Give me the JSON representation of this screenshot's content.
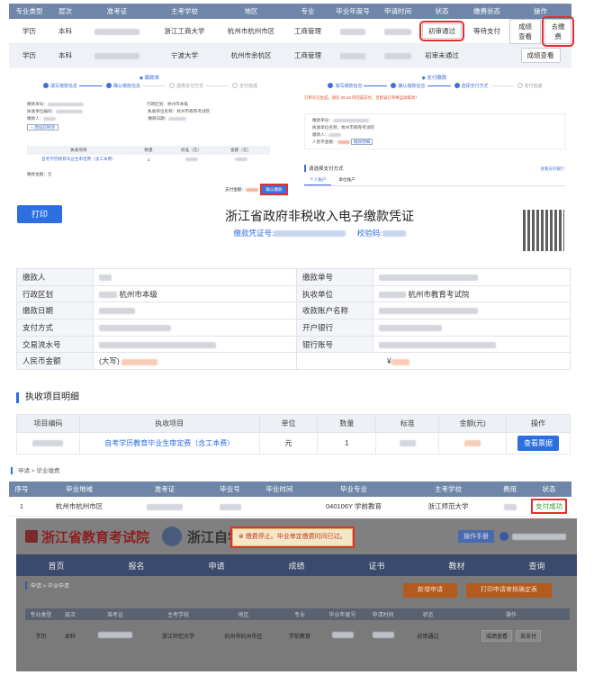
{
  "top_table": {
    "headers": [
      "专业类型",
      "层次",
      "准考证",
      "主考学校",
      "地区",
      "专业",
      "毕业年度号",
      "申请时间",
      "状态",
      "缴费状态",
      "操作"
    ],
    "rows": [
      {
        "type": "学历",
        "level": "本科",
        "school": "浙江工商大学",
        "region": "杭州市杭州市区",
        "major": "工商管理",
        "status": "初审通过",
        "pay_status": "等待支付",
        "btn1": "成绩查看",
        "btn2": "去缴费"
      },
      {
        "type": "学历",
        "level": "本科",
        "school": "宁波大学",
        "region": "杭州市余杭区",
        "major": "工商管理",
        "status": "初审未通过",
        "btn1": "成绩查看"
      }
    ]
  },
  "left_panel": {
    "title": "缴款单",
    "steps": [
      "填写缴款信息",
      "确认缴款信息",
      "选择支付方式",
      "支付完成"
    ],
    "labels": [
      "缴款单号：",
      "执收单位编码：",
      "缴款人：",
      "行政区划：",
      "执收单位名称：",
      "缴款日期："
    ],
    "values": [
      "杭州市本级",
      "杭州市教育考试院"
    ],
    "add_link": "+ 添加非税项",
    "item_head": [
      "执收项目",
      "数量",
      "标准（元）",
      "金额（元）"
    ],
    "item": "自考学历教育毕业生审定费（含工本费）",
    "qty": "1",
    "total_label": "缴款金额：元",
    "pay_label": "支付金额：",
    "confirm": "确认缴款"
  },
  "right_panel": {
    "title": "支付缴款",
    "steps": [
      "填写缴款信息",
      "确认缴款信息",
      "选择支付方式",
      "支付完成"
    ],
    "warning": "订单号已生成，请在 29:43 内完成支付，否则该订单将自动取消！",
    "labels": [
      "缴款单号：",
      "执收单位名称：杭州市教育考试院",
      "缴款人：",
      "人民币金额："
    ],
    "detail": "缴款明细",
    "section": "请选择支付方式",
    "bank_link": "查看支持银行",
    "tabs": [
      "个人账户",
      "单位账户"
    ]
  },
  "voucher": {
    "print": "打印",
    "title": "浙江省政府非税收入电子缴款凭证",
    "code_label": "缴款凭证号:",
    "check_label": "校验码:",
    "rows": [
      [
        "缴款人",
        "",
        "缴款单号",
        ""
      ],
      [
        "行政区划",
        "杭州市本级",
        "执收单位",
        "杭州市教育考试院"
      ],
      [
        "缴款日期",
        "",
        "收款账户名称",
        ""
      ],
      [
        "支付方式",
        "",
        "开户银行",
        ""
      ],
      [
        "交易流水号",
        "",
        "银行账号",
        ""
      ],
      [
        "人民币金额",
        "(大写)",
        "",
        "¥"
      ]
    ],
    "section": "执收项目明细",
    "item_headers": [
      "项目编码",
      "执收项目",
      "单位",
      "数量",
      "标准",
      "金额(元)",
      "操作"
    ],
    "item": {
      "name": "自考学历教育毕业生审定费（含工本费）",
      "unit": "元",
      "qty": "1",
      "btn": "查看票据"
    }
  },
  "table3": {
    "crumb": "申请  >  毕业缴费",
    "headers": [
      "序号",
      "毕业地域",
      "准考证",
      "毕业号",
      "毕业时间",
      "毕业专业",
      "主考学校",
      "费用",
      "状态"
    ],
    "row": {
      "no": "1",
      "region": "杭州市杭州市区",
      "major": "040106Y 学前教育",
      "school": "浙江师范大学",
      "status": "支付成功"
    }
  },
  "site": {
    "name": "浙江省教育考试院",
    "name2": "浙江自学",
    "alert": "缴费停止。毕业审定缴费时间已过。",
    "manual": "操作手册",
    "nav": [
      "首页",
      "报名",
      "申请",
      "成绩",
      "证书",
      "教材",
      "查询"
    ],
    "crumb": "申请  >  毕业申请",
    "btn_new": "新增申请",
    "btn_print": "打印申请审核确定表",
    "headers": [
      "专业类型",
      "层次",
      "准考证",
      "主考学校",
      "地区",
      "专业",
      "毕业年度号",
      "申请时间",
      "状态",
      "操作"
    ],
    "row": {
      "type": "学历",
      "level": "本科",
      "school": "浙江师范大学",
      "region": "杭州市杭州市区",
      "major": "学前教育",
      "status": "初审通过",
      "btn1": "成绩查看",
      "btn2": "去支付"
    }
  }
}
